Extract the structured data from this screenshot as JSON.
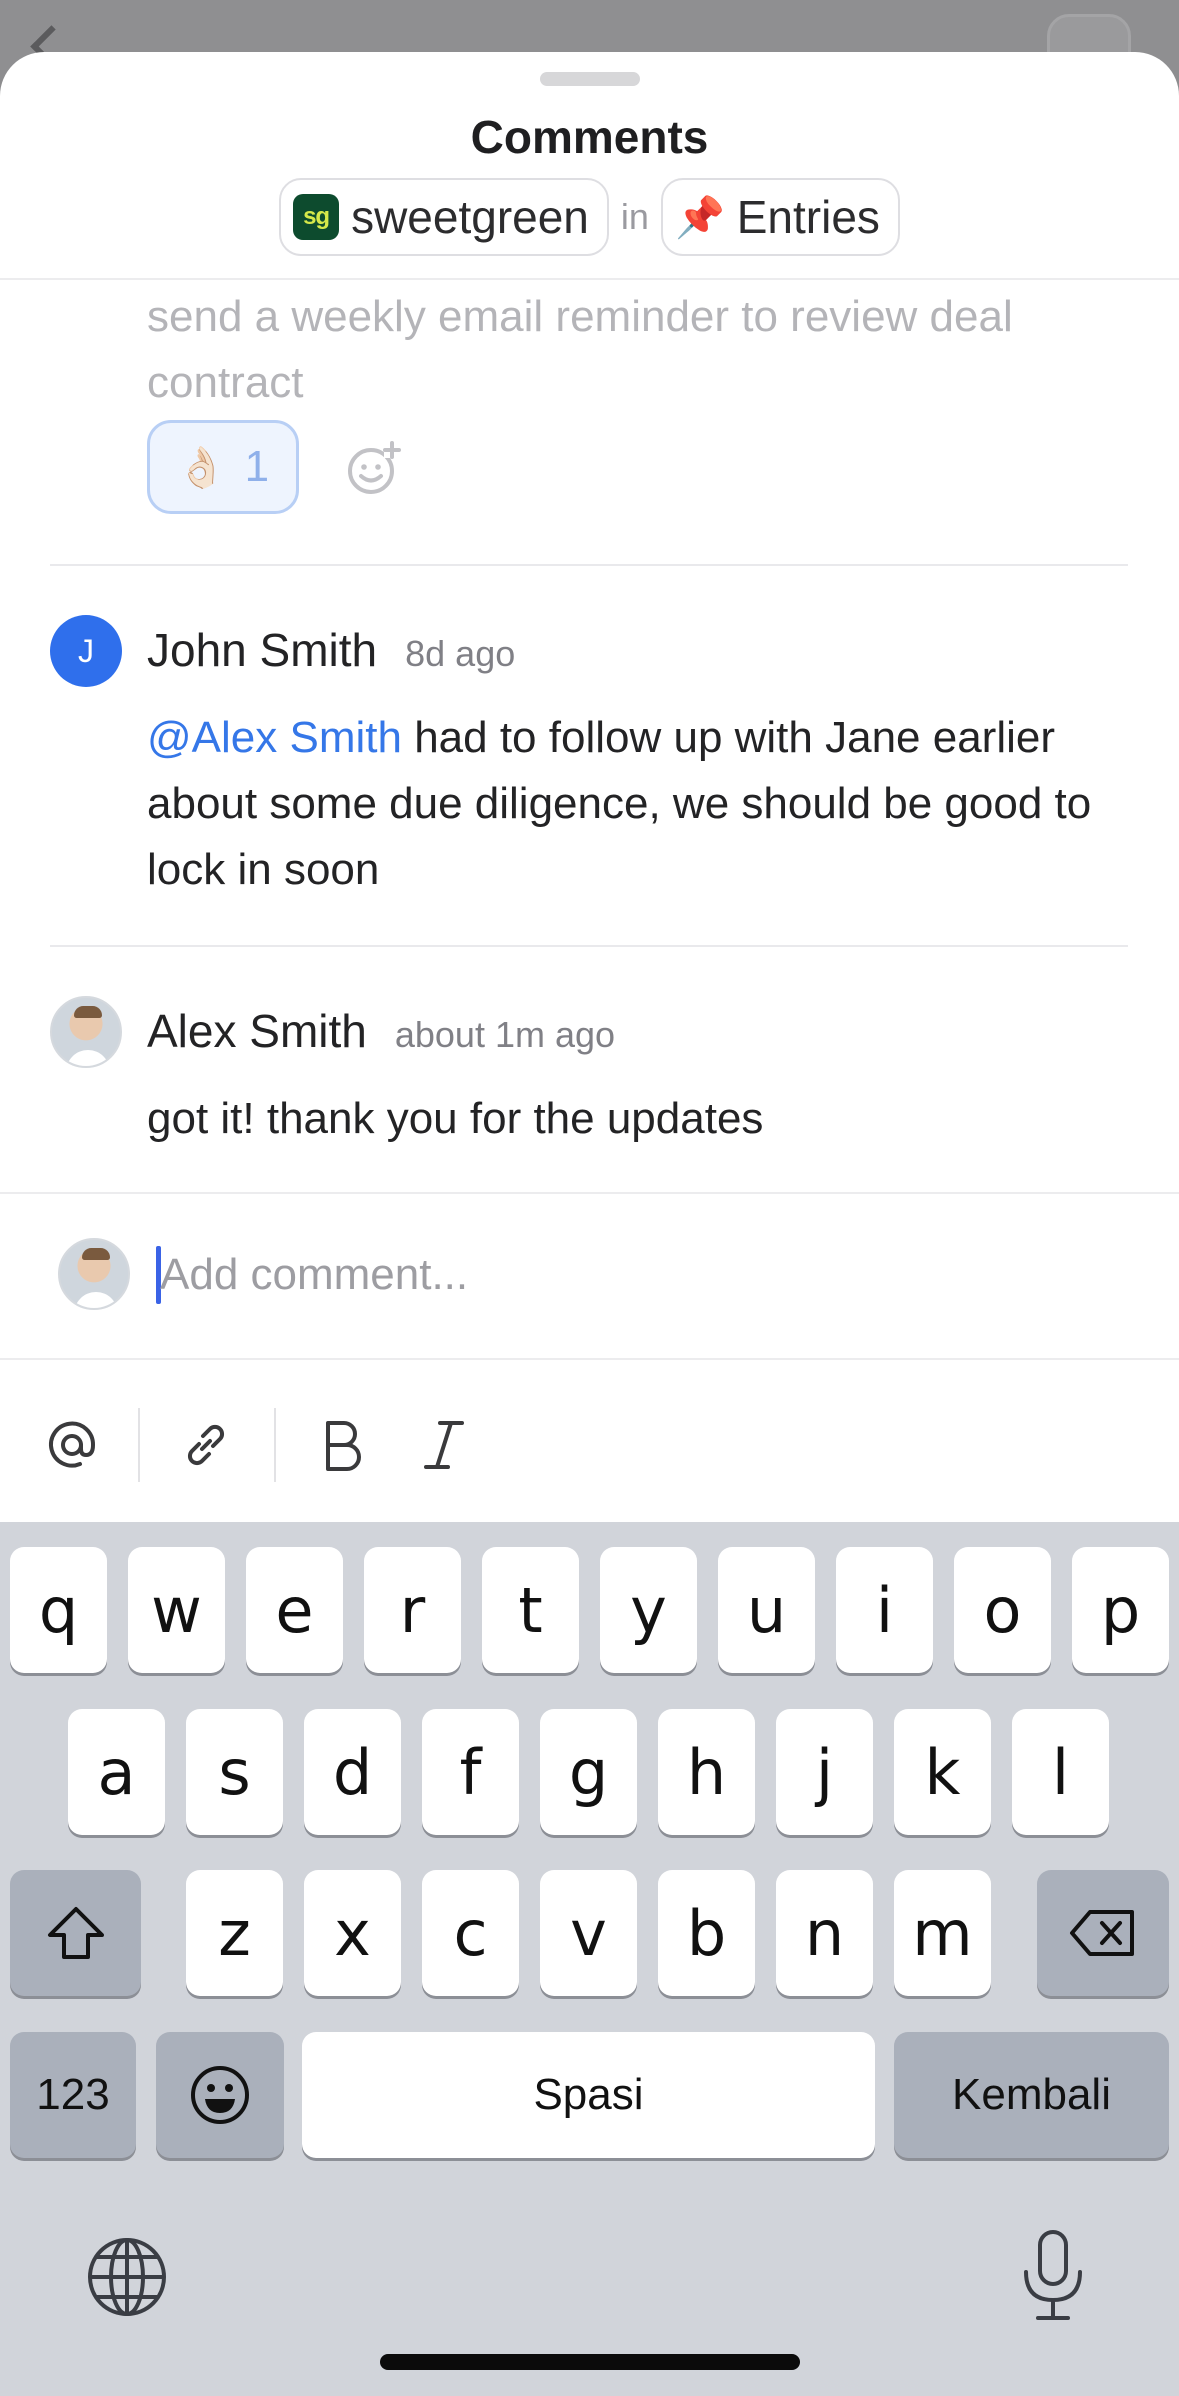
{
  "sheet": {
    "title": "Comments",
    "context": {
      "company": "sweetgreen",
      "company_logo_text": "sg",
      "connector": "in",
      "list_icon": "📌",
      "list": "Entries"
    }
  },
  "thread": {
    "previous_comment_tail": "send a weekly email reminder to review deal contract",
    "reaction": {
      "emoji": "👌🏻",
      "count": "1"
    },
    "comments": [
      {
        "author": "John Smith",
        "avatar_letter": "J",
        "time": "8d ago",
        "mention": "@Alex Smith",
        "body": " had to follow up with Jane earlier about some due diligence, we should be good to lock in soon"
      },
      {
        "author": "Alex Smith",
        "time": "about 1m ago",
        "body": "got it! thank you for the updates"
      }
    ]
  },
  "composer": {
    "placeholder": "Add comment...",
    "value": ""
  },
  "keyboard": {
    "row1": [
      "q",
      "w",
      "e",
      "r",
      "t",
      "y",
      "u",
      "i",
      "o",
      "p"
    ],
    "row2": [
      "a",
      "s",
      "d",
      "f",
      "g",
      "h",
      "j",
      "k",
      "l"
    ],
    "row3": [
      "z",
      "x",
      "c",
      "v",
      "b",
      "n",
      "m"
    ],
    "numbers_label": "123",
    "space_label": "Spasi",
    "return_label": "Kembali"
  },
  "icons": {
    "toolbar": [
      "at-icon",
      "link-icon",
      "bold-icon",
      "italic-icon"
    ],
    "add_reaction": "add-reaction-icon",
    "shift": "shift-icon",
    "delete": "backspace-icon",
    "emoji": "emoji-icon",
    "globe": "globe-icon",
    "mic": "microphone-icon"
  },
  "colors": {
    "mention": "#3577e8",
    "avatar_john": "#2f6fec",
    "caret": "#3a63e6",
    "keyboard_bg": "#d1d4da"
  }
}
